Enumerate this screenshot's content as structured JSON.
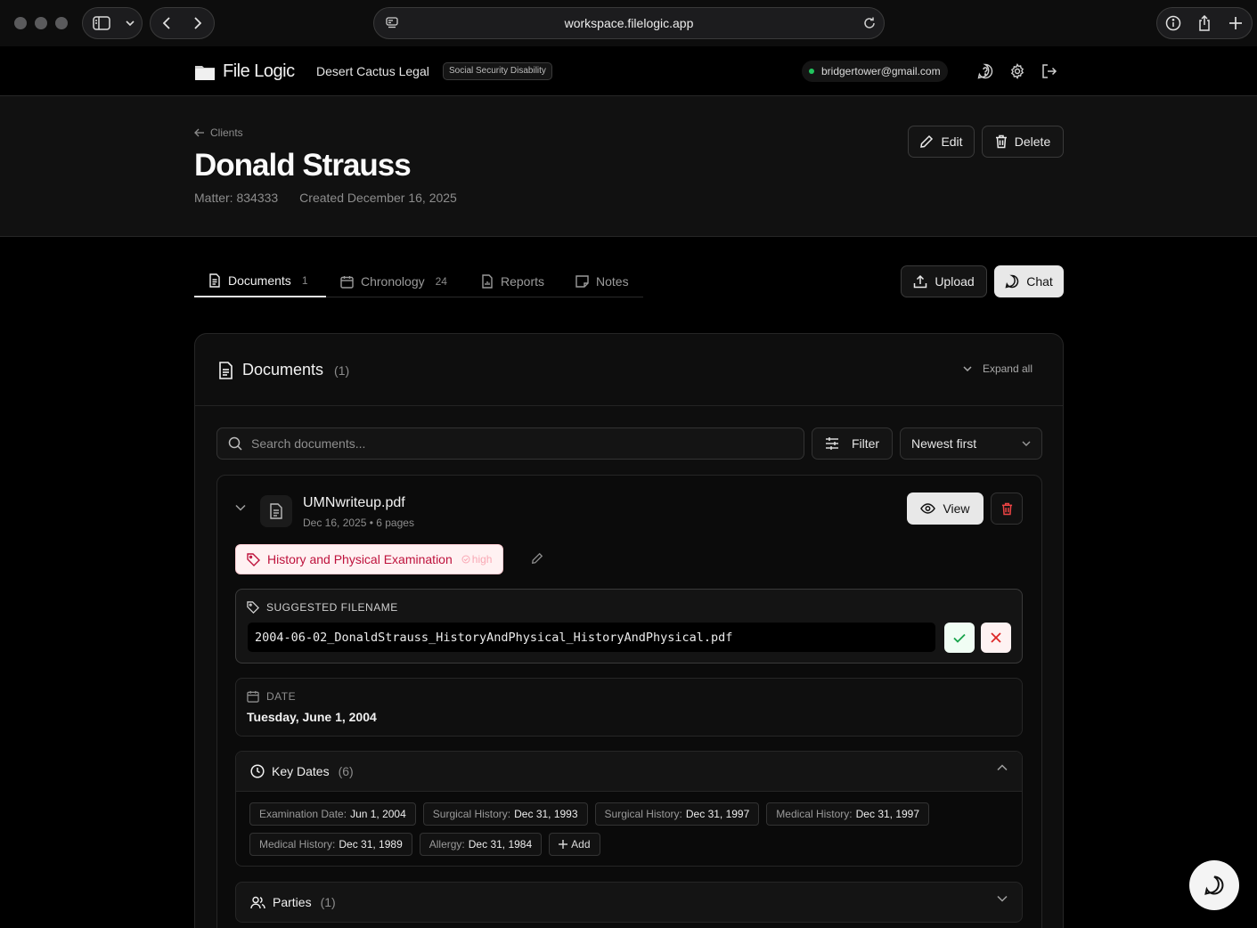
{
  "browser": {
    "url": "workspace.filelogic.app"
  },
  "app": {
    "name": "File Logic",
    "firm": "Desert Cactus Legal",
    "practice_area": "Social Security Disability",
    "user_email": "bridgertower@gmail.com",
    "status_color": "#22c55e"
  },
  "client": {
    "breadcrumb": "Clients",
    "name": "Donald Strauss",
    "matter": "Matter: 834333",
    "created": "Created December 16, 2025",
    "edit_label": "Edit",
    "delete_label": "Delete"
  },
  "tabs": [
    {
      "label": "Documents",
      "count": "1"
    },
    {
      "label": "Chronology",
      "count": "24"
    },
    {
      "label": "Reports",
      "count": ""
    },
    {
      "label": "Notes",
      "count": ""
    }
  ],
  "actions": {
    "upload_label": "Upload",
    "chat_label": "Chat"
  },
  "documents_panel": {
    "title": "Documents",
    "count": "(1)",
    "expand_label": "Expand all",
    "search_placeholder": "Search documents...",
    "filter_label": "Filter",
    "sort_value": "Newest first"
  },
  "document": {
    "filename": "UMNwriteup.pdf",
    "meta": "Dec 16, 2025 • 6 pages",
    "view_label": "View",
    "tag_label": "History and Physical Examination",
    "tag_confidence": "high",
    "suggested_label": "SUGGESTED FILENAME",
    "suggested_filename": "2004-06-02_DonaldStrauss_HistoryAndPhysical_HistoryAndPhysical.pdf",
    "date_label": "DATE",
    "date_value": "Tuesday, June 1, 2004",
    "key_dates_title": "Key Dates",
    "key_dates_count": "(6)",
    "key_dates": [
      {
        "label": "Examination Date:",
        "value": "Jun 1, 2004"
      },
      {
        "label": "Surgical History:",
        "value": "Dec 31, 1993"
      },
      {
        "label": "Surgical History:",
        "value": "Dec 31, 1997"
      },
      {
        "label": "Medical History:",
        "value": "Dec 31, 1997"
      },
      {
        "label": "Medical History:",
        "value": "Dec 31, 1989"
      },
      {
        "label": "Allergy:",
        "value": "Dec 31, 1984"
      }
    ],
    "add_label": "Add",
    "parties_title": "Parties",
    "parties_count": "(1)"
  }
}
